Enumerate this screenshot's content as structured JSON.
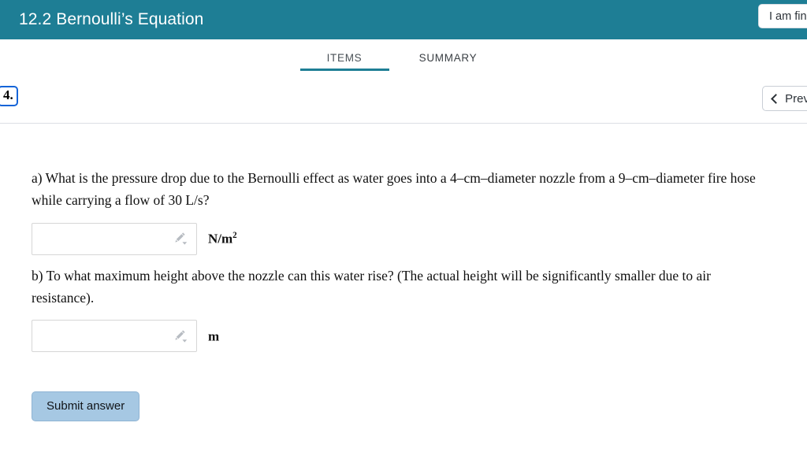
{
  "header": {
    "title": "12.2 Bernoulli’s Equation",
    "finish_button_label": "I am finished",
    "background_color": "#1e7e95"
  },
  "tabs": [
    {
      "label": "ITEMS",
      "active": true
    },
    {
      "label": "SUMMARY",
      "active": false
    }
  ],
  "item_nav": {
    "item_number": "4.",
    "prev_button_label": "Prev",
    "prev_icon": "chevron-left-icon",
    "badge_border_color": "#1464d8"
  },
  "question": {
    "part_a": {
      "text": "a) What is the pressure drop due to the Bernoulli effect as water goes into a 4–cm–diameter nozzle from a 9–cm–diameter fire hose while carrying a flow of 30 L/s?",
      "answer_value": "",
      "answer_placeholder": "",
      "unit_base": "N/m",
      "unit_exponent": "2",
      "edit_icon": "pencil-icon",
      "dropdown_icon": "caret-down-icon"
    },
    "part_b": {
      "text": "b) To what maximum height above the nozzle can this water rise? (The actual height will be significantly smaller due to air resistance).",
      "answer_value": "",
      "answer_placeholder": "",
      "unit_base": "m",
      "unit_exponent": "",
      "edit_icon": "pencil-icon",
      "dropdown_icon": "caret-down-icon"
    }
  },
  "actions": {
    "submit_label": "Submit answer",
    "submit_color": "#a6c8e3"
  }
}
